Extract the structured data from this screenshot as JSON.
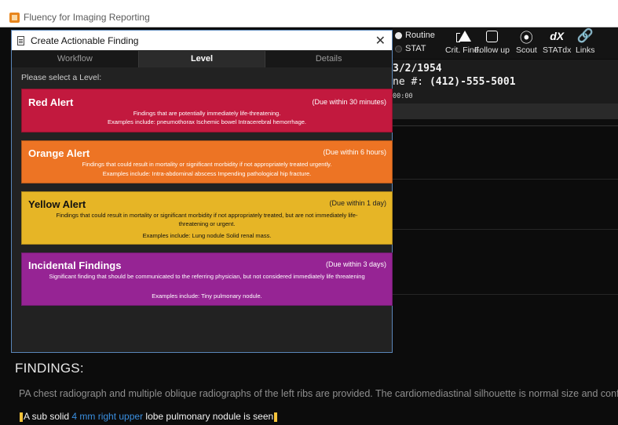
{
  "app": {
    "title": "Fluency for Imaging Reporting"
  },
  "toolbar": {
    "routine_label": "Routine",
    "stat_label": "STAT",
    "crit_find_label": "Crit. Find.",
    "follow_up_label": "Follow up",
    "scout_label": "Scout",
    "statdx_label": "STATdx",
    "statdx_glyph": "dX",
    "links_label": "Links"
  },
  "patient": {
    "dob_partial": "3/2/1954",
    "phone_prefix": "ne #: ",
    "phone": "(412)-555-5001",
    "time_partial": "00:00"
  },
  "modal": {
    "title": "Create Actionable Finding",
    "close_glyph": "✕",
    "tabs": [
      "Workflow",
      "Level",
      "Details"
    ],
    "active_tab": "Level",
    "prompt": "Please select a Level:",
    "levels": [
      {
        "name": "Red Alert",
        "due": "(Due within 30 minutes)",
        "description": "Findings that are potentially immediately life-threatening.",
        "examples": "Examples include: pneumothorax Ischemic bowel Intracerebral hemorrhage.",
        "color": "#c2193e"
      },
      {
        "name": "Orange Alert",
        "due": "(Due within 6 hours)",
        "description": "Findings that could result in mortality or significant morbidity if not appropriately treated urgently.",
        "examples": "Examples include: Intra-abdominal abscess Impending pathological hip fracture.",
        "color": "#ed7424"
      },
      {
        "name": "Yellow Alert",
        "due": "(Due within 1 day)",
        "description": "Findings that could result in mortality or significant morbidity if not appropriately treated, but are not immediately life-threatening or urgent.",
        "examples": "Examples include: Lung nodule Solid renal mass.",
        "color": "#e6b526"
      },
      {
        "name": "Incidental Findings",
        "due": "(Due within 3 days)",
        "description": "Significant finding that should be communicated to the referring physician, but not considered immediately life threatening",
        "examples": "Examples include: Tiny pulmonary nodule.",
        "color": "#962494"
      }
    ]
  },
  "report": {
    "findings_heading": "FINDINGS:",
    "findings_text": "PA chest radiograph and multiple oblique radiographs of the left ribs are provided. The cardiomediastinal silhouette is normal size and configuration",
    "finding_part1": "A sub solid ",
    "finding_highlight": "4 mm right upper",
    "finding_part2": " lobe pulmonary nodule is seen"
  }
}
